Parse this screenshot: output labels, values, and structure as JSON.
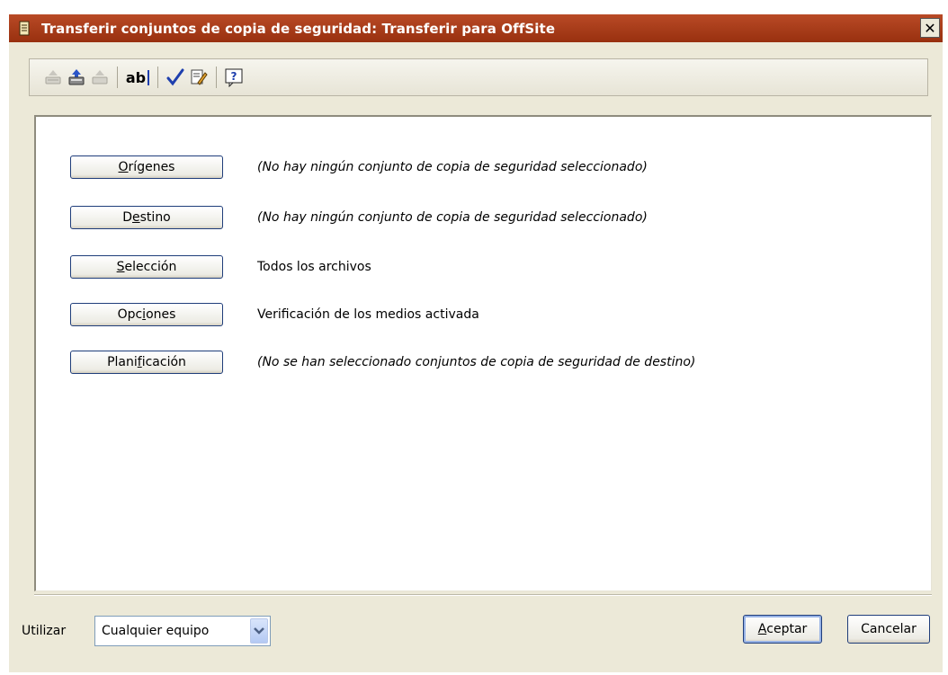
{
  "window": {
    "title": "Transferir conjuntos de copia de seguridad: Transferir para OffSite",
    "close_label": "✕",
    "icon": "script-icon"
  },
  "toolbar": {
    "buttons": [
      {
        "name": "eject-icon",
        "enabled": false
      },
      {
        "name": "tray-up-icon",
        "enabled": true
      },
      {
        "name": "eject-alt-icon",
        "enabled": false
      },
      {
        "name": "rename-icon",
        "label": "ab"
      },
      {
        "name": "check-icon"
      },
      {
        "name": "edit-script-icon"
      },
      {
        "name": "help-icon",
        "label": "?"
      }
    ]
  },
  "rows": [
    {
      "pre": "",
      "access": "O",
      "post": "rígenes",
      "desc": "(No hay ningún conjunto de copia de seguridad seleccionado)",
      "italic": true
    },
    {
      "pre": "D",
      "access": "e",
      "post": "stino",
      "desc": "(No hay ningún conjunto de copia de seguridad seleccionado)",
      "italic": true
    },
    {
      "pre": "",
      "access": "S",
      "post": "elección",
      "desc": "Todos los archivos",
      "italic": false
    },
    {
      "pre": "Opc",
      "access": "i",
      "post": "ones",
      "desc": "Verificación de los medios activada",
      "italic": false
    },
    {
      "pre": "Plani",
      "access": "f",
      "post": "icación",
      "desc": "(No se han seleccionado conjuntos de copia de seguridad de destino)",
      "italic": true
    }
  ],
  "footer": {
    "utilizar_label": "Utilizar",
    "combo_value": "Cualquier equipo",
    "accept": {
      "access": "A",
      "rest": "ceptar"
    },
    "cancel_label": "Cancelar"
  },
  "colors": {
    "titlebar": "#a93a1a",
    "dialog_bg": "#ece9d8",
    "button_border": "#1f3d7a",
    "check_blue": "#1e3fae"
  }
}
